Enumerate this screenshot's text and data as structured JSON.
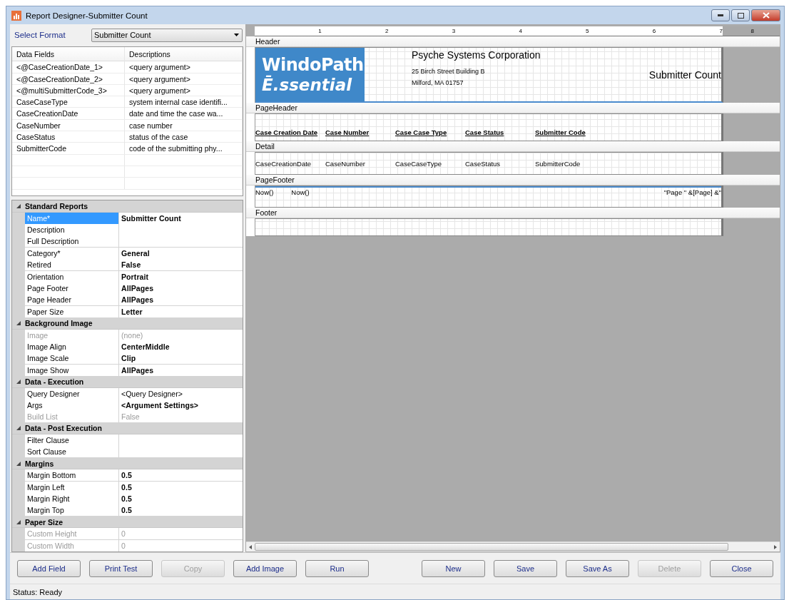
{
  "window": {
    "title": "Report Designer-Submitter Count"
  },
  "select_format": {
    "label": "Select Format",
    "value": "Submitter Count"
  },
  "data_fields": {
    "columns": [
      "Data Fields",
      "Descriptions"
    ],
    "rows": [
      {
        "field": "<@CaseCreationDate_1>",
        "description": "<query argument>"
      },
      {
        "field": "<@CaseCreationDate_2>",
        "description": "<query argument>"
      },
      {
        "field": "<@multiSubmitterCode_3>",
        "description": "<query argument>"
      },
      {
        "field": "CaseCaseType",
        "description": "system internal case identifi..."
      },
      {
        "field": "CaseCreationDate",
        "description": "date and time the case wa..."
      },
      {
        "field": "CaseNumber",
        "description": "case number"
      },
      {
        "field": "CaseStatus",
        "description": "status of the case"
      },
      {
        "field": "SubmitterCode",
        "description": "code of the submitting phy..."
      }
    ]
  },
  "properties": [
    {
      "category": "Standard Reports",
      "expanded": true,
      "items": [
        {
          "kind": "set",
          "name": "Name*",
          "value": "Submitter Count",
          "selected": true,
          "disabled": false
        },
        {
          "kind": "default",
          "name": "Description",
          "selected": false,
          "disabled": false
        },
        {
          "kind": "default",
          "name": "Full Description",
          "selected": false,
          "disabled": false
        },
        {
          "kind": "set",
          "name": "Category*",
          "value": "General",
          "selected": false,
          "disabled": false
        },
        {
          "kind": "set",
          "name": "Retired",
          "value": "False",
          "selected": false,
          "disabled": false
        },
        {
          "kind": "set",
          "name": "Orientation",
          "value": "Portrait",
          "selected": false,
          "disabled": false
        },
        {
          "kind": "set",
          "name": "Page Footer",
          "value": "AllPages",
          "selected": false,
          "disabled": false
        },
        {
          "kind": "set",
          "name": "Page Header",
          "value": "AllPages",
          "selected": false,
          "disabled": false
        },
        {
          "kind": "set",
          "name": "Paper Size",
          "value": "Letter",
          "selected": false,
          "disabled": false
        }
      ]
    },
    {
      "category": "Background Image",
      "expanded": true,
      "items": [
        {
          "kind": "default",
          "name": "Image",
          "value": "(none)",
          "selected": false,
          "disabled": true
        },
        {
          "kind": "set",
          "name": "Image Align",
          "value": "CenterMiddle",
          "selected": false,
          "disabled": false
        },
        {
          "kind": "set",
          "name": "Image Scale",
          "value": "Clip",
          "selected": false,
          "disabled": false
        },
        {
          "kind": "set",
          "name": "Image Show",
          "value": "AllPages",
          "selected": false,
          "disabled": false
        }
      ]
    },
    {
      "category": "Data - Execution",
      "expanded": true,
      "items": [
        {
          "kind": "default",
          "name": "Query Designer",
          "value": "<Query Designer>",
          "selected": false,
          "disabled": false
        },
        {
          "kind": "set",
          "name": "Args",
          "value": "<Argument Settings>",
          "selected": false,
          "disabled": false
        },
        {
          "kind": "default",
          "name": "Build List",
          "value": "False",
          "selected": false,
          "disabled": true
        }
      ]
    },
    {
      "category": "Data - Post Execution",
      "expanded": true,
      "items": [
        {
          "kind": "default",
          "name": "Filter Clause",
          "selected": false,
          "disabled": false
        },
        {
          "kind": "default",
          "name": "Sort Clause",
          "selected": false,
          "disabled": false
        }
      ]
    },
    {
      "category": "Margins",
      "expanded": true,
      "items": [
        {
          "kind": "set",
          "name": "Margin Bottom",
          "value": "0.5",
          "selected": false,
          "disabled": false
        },
        {
          "kind": "set",
          "name": "Margin Left",
          "value": "0.5",
          "selected": false,
          "disabled": false
        },
        {
          "kind": "set",
          "name": "Margin Right",
          "value": "0.5",
          "selected": false,
          "disabled": false
        },
        {
          "kind": "set",
          "name": "Margin Top",
          "value": "0.5",
          "selected": false,
          "disabled": false
        }
      ]
    },
    {
      "category": "Paper Size",
      "expanded": true,
      "items": [
        {
          "kind": "default",
          "name": "Custom Height",
          "value": "0",
          "selected": false,
          "disabled": true
        },
        {
          "kind": "default",
          "name": "Custom Width",
          "value": "0",
          "selected": false,
          "disabled": true
        }
      ]
    }
  ],
  "ruler": [
    "1",
    "2",
    "3",
    "4",
    "5",
    "6",
    "7",
    "8"
  ],
  "report": {
    "header": {
      "label": "Header",
      "logo_line_1": "WindoPath",
      "logo_line_2": "Ē.ssential",
      "company": "Psyche Systems Corporation",
      "address_1": "25 Birch Street Building B",
      "address_2": "Milford, MA 01757",
      "title": "Submitter Count"
    },
    "page_header": {
      "label": "PageHeader",
      "columns": [
        "Case Creation Date",
        "Case Number",
        "Case Case Type",
        "Case Status",
        "Submitter Code"
      ]
    },
    "detail": {
      "label": "Detail",
      "fields": [
        "CaseCreationDate",
        "CaseNumber",
        "CaseCaseType",
        "CaseStatus",
        "SubmitterCode"
      ]
    },
    "page_footer": {
      "label": "PageFooter",
      "left": [
        "Now()",
        "Now()"
      ],
      "right": "\"Page \" &[Page] &\""
    },
    "footer": {
      "label": "Footer"
    }
  },
  "buttons": [
    {
      "label": "Add Field",
      "disabled": false
    },
    {
      "label": "Print Test",
      "disabled": false
    },
    {
      "label": "Copy",
      "disabled": true
    },
    {
      "label": "Add Image",
      "disabled": false
    },
    {
      "label": "Run",
      "disabled": false
    },
    {
      "label": "New",
      "disabled": false
    },
    {
      "label": "Save",
      "disabled": false
    },
    {
      "label": "Save As",
      "disabled": false
    },
    {
      "label": "Delete",
      "disabled": true
    },
    {
      "label": "Close",
      "disabled": false
    }
  ],
  "status_bar": "Status: Ready"
}
